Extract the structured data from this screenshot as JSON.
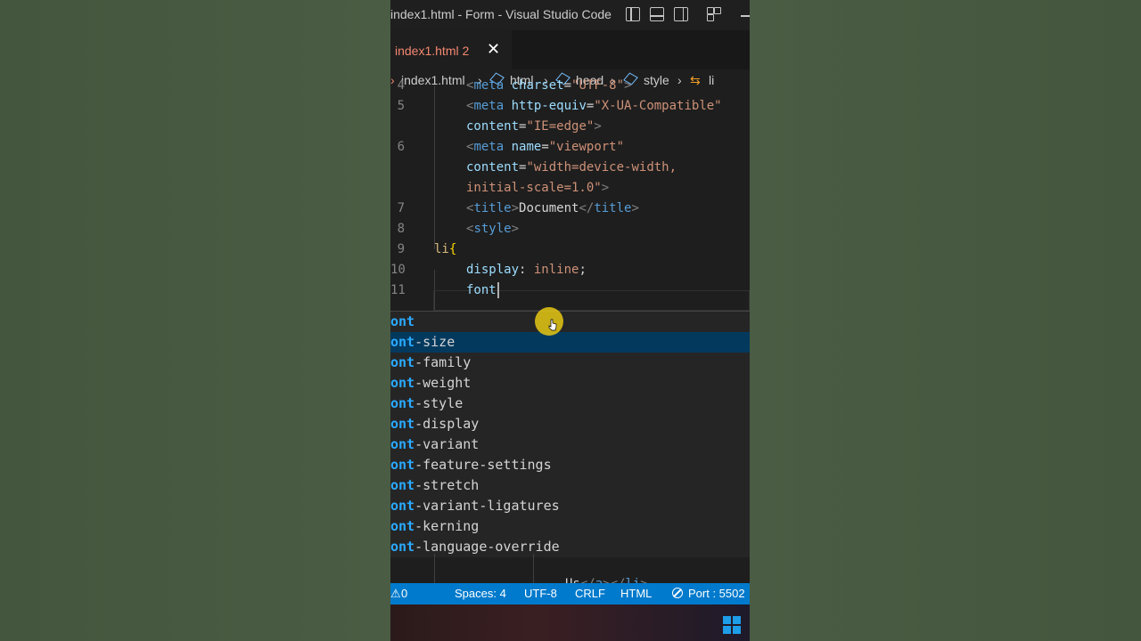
{
  "window": {
    "title": "index1.html - Form - Visual Studio Code"
  },
  "tab": {
    "name": "index1.html",
    "problems": "2",
    "close": "✕"
  },
  "breadcrumb": [
    "index1.html",
    "html",
    "head",
    "style",
    "li"
  ],
  "editor": {
    "lines": [
      {
        "n": "4",
        "parts": [
          [
            "tag",
            "<"
          ],
          [
            "tname",
            "meta"
          ],
          [
            "attr",
            " charset"
          ],
          [
            "txt",
            "="
          ],
          [
            "str",
            "\"UTF-8\""
          ],
          [
            "tag",
            ">"
          ]
        ]
      },
      {
        "n": "5",
        "parts": [
          [
            "tag",
            "<"
          ],
          [
            "tname",
            "meta"
          ],
          [
            "attr",
            " http-equiv"
          ],
          [
            "txt",
            "="
          ],
          [
            "str",
            "\"X-UA-Compatible\""
          ]
        ]
      },
      {
        "n": "",
        "parts": [
          [
            "attr",
            "content"
          ],
          [
            "txt",
            "="
          ],
          [
            "str",
            "\"IE=edge\""
          ],
          [
            "tag",
            ">"
          ]
        ]
      },
      {
        "n": "6",
        "parts": [
          [
            "tag",
            "<"
          ],
          [
            "tname",
            "meta"
          ],
          [
            "attr",
            " name"
          ],
          [
            "txt",
            "="
          ],
          [
            "str",
            "\"viewport\""
          ]
        ]
      },
      {
        "n": "",
        "parts": [
          [
            "attr",
            "content"
          ],
          [
            "txt",
            "="
          ],
          [
            "str",
            "\"width=device-width,"
          ]
        ]
      },
      {
        "n": "",
        "parts": [
          [
            "str",
            "initial-scale=1.0\""
          ],
          [
            "tag",
            ">"
          ]
        ]
      },
      {
        "n": "7",
        "parts": [
          [
            "tag",
            "<"
          ],
          [
            "tname",
            "title"
          ],
          [
            "tag",
            ">"
          ],
          [
            "txt",
            "Document"
          ],
          [
            "tag",
            "</"
          ],
          [
            "tname",
            "title"
          ],
          [
            "tag",
            ">"
          ]
        ]
      },
      {
        "n": "8",
        "parts": [
          [
            "tag",
            "<"
          ],
          [
            "tname",
            "style"
          ],
          [
            "tag",
            ">"
          ]
        ]
      },
      {
        "n": "9",
        "parts": [
          [
            "sel",
            "li"
          ],
          [
            "brace",
            "{"
          ]
        ]
      },
      {
        "n": "10",
        "parts": [
          [
            "prop",
            "display"
          ],
          [
            "txt",
            ": "
          ],
          [
            "val",
            "inline"
          ],
          [
            "txt",
            ";"
          ]
        ]
      },
      {
        "n": "11",
        "parts": [
          [
            "prop",
            "font"
          ]
        ]
      }
    ],
    "after_line": {
      "parts": [
        [
          "txt",
          "Us"
        ],
        [
          "tag",
          "</"
        ],
        [
          "tname",
          "a"
        ],
        [
          "tag",
          "></"
        ],
        [
          "tname",
          "li"
        ],
        [
          "tag",
          ">"
        ]
      ]
    }
  },
  "suggestions": {
    "typed_prefix": "ont",
    "items": [
      {
        "label": "font",
        "match": "ont",
        "rest": ""
      },
      {
        "label": "font-size",
        "match": "ont",
        "rest": "-size"
      },
      {
        "label": "font-family",
        "match": "ont",
        "rest": "-family"
      },
      {
        "label": "font-weight",
        "match": "ont",
        "rest": "-weight"
      },
      {
        "label": "font-style",
        "match": "ont",
        "rest": "-style"
      },
      {
        "label": "font-display",
        "match": "ont",
        "rest": "-display"
      },
      {
        "label": "font-variant",
        "match": "ont",
        "rest": "-variant"
      },
      {
        "label": "font-feature-settings",
        "match": "ont",
        "rest": "-feature-settings"
      },
      {
        "label": "font-stretch",
        "match": "ont",
        "rest": "-stretch"
      },
      {
        "label": "font-variant-ligatures",
        "match": "ont",
        "rest": "-variant-ligatures"
      },
      {
        "label": "font-kerning",
        "match": "ont",
        "rest": "-kerning"
      },
      {
        "label": "font-language-override",
        "match": "ont",
        "rest": "-language-override"
      }
    ],
    "selected_index": 1
  },
  "statusbar": {
    "warnings": "0",
    "spaces": "Spaces: 4",
    "encoding": "UTF-8",
    "eol": "CRLF",
    "language": "HTML",
    "port": "Port : 5502"
  },
  "colors": {
    "statusbar": "#007acc",
    "selection": "#04395e",
    "match": "#2aaaff",
    "tab_error": "#f48771"
  }
}
